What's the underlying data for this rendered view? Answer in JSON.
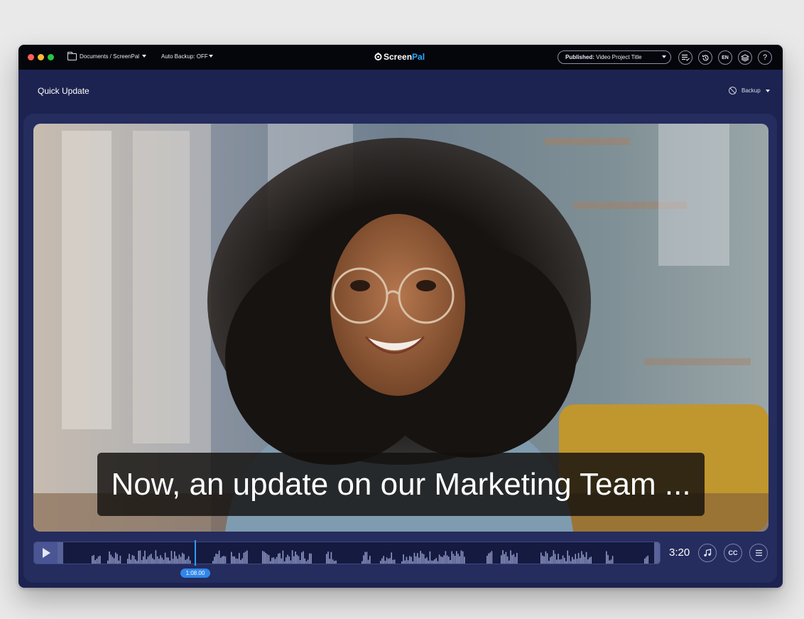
{
  "titlebar": {
    "breadcrumb": "Documents / ScreenPal",
    "auto_backup": "Auto Backup: OFF",
    "logo_screen": "Screen",
    "logo_pal": "Pal",
    "publish_prefix": "Published:",
    "publish_title": "Video Project Title",
    "icons": [
      "checklist-icon",
      "history-icon",
      "language-icon",
      "layers-icon",
      "help-icon"
    ],
    "lang_label": "EN",
    "help_label": "?"
  },
  "header": {
    "title": "Quick Update",
    "backup_label": "Backup"
  },
  "player": {
    "subtitle": "Now, an update on our Marketing Team ...",
    "playhead_time": "1:08.00",
    "duration": "3:20",
    "cc_label": "CC",
    "progress_fraction": 0.23
  },
  "colors": {
    "accent": "#2f86ea",
    "panel": "#1d2350",
    "logo_pal": "#2ea8ff"
  }
}
